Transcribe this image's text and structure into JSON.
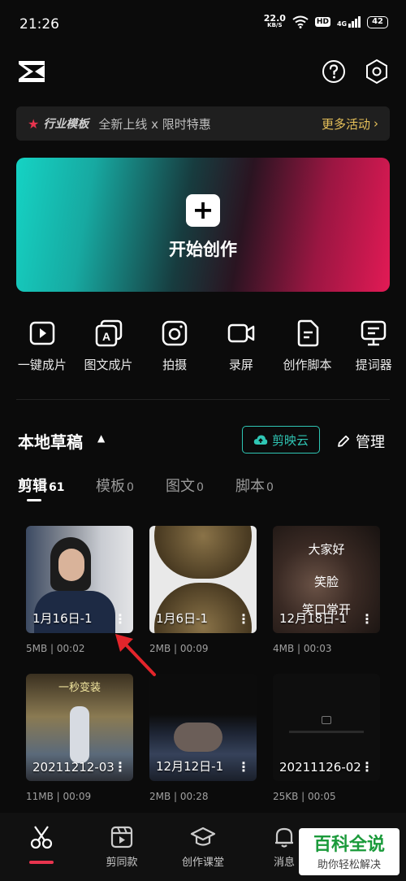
{
  "status_bar": {
    "time": "21:26",
    "net_speed_value": "22.0",
    "net_speed_unit": "KB/S",
    "hd": "HD",
    "network": "4G",
    "battery": "42"
  },
  "header": {
    "logo_icon": "capcut-logo-icon",
    "help_icon": "help-circle-icon",
    "settings_icon": "hexagon-settings-icon"
  },
  "promo": {
    "tag": "行业模板",
    "text": "全新上线 x 限时特惠",
    "more": "更多活动",
    "star_color": "#e8344e",
    "more_color": "#e7c15a"
  },
  "create": {
    "plus": "+",
    "label": "开始创作"
  },
  "tools": [
    {
      "icon": "play-square-icon",
      "label": "一键成片"
    },
    {
      "icon": "image-text-icon",
      "label": "图文成片"
    },
    {
      "icon": "camera-icon",
      "label": "拍摄"
    },
    {
      "icon": "video-record-icon",
      "label": "录屏"
    },
    {
      "icon": "script-doc-icon",
      "label": "创作脚本"
    },
    {
      "icon": "teleprompter-icon",
      "label": "提词器"
    }
  ],
  "drafts": {
    "title": "本地草稿",
    "cloud_label": "剪映云",
    "manage_label": "管理",
    "accent": "#2fc6b4"
  },
  "tabs": [
    {
      "label": "剪辑",
      "count": "61",
      "active": true
    },
    {
      "label": "模板",
      "count": "0"
    },
    {
      "label": "图文",
      "count": "0"
    },
    {
      "label": "脚本",
      "count": "0"
    }
  ],
  "items": [
    {
      "title": "1月16日-1",
      "meta": "5MB | 00:02"
    },
    {
      "title": "1月6日-1",
      "meta": "2MB | 00:09"
    },
    {
      "title": "12月18日-1",
      "meta": "4MB | 00:03",
      "overlay": [
        "大家好",
        "笑脸",
        "笑口常开"
      ]
    },
    {
      "title": "20211212-03",
      "meta": "11MB | 00:09",
      "overlay": [
        "一秒变装"
      ]
    },
    {
      "title": "12月12日-1",
      "meta": "2MB | 00:28"
    },
    {
      "title": "20211126-02",
      "meta": "25KB | 00:05"
    }
  ],
  "bottom_nav": [
    {
      "icon": "scissors-icon",
      "label": "",
      "active": true
    },
    {
      "icon": "template-clapper-icon",
      "label": "剪同款"
    },
    {
      "icon": "graduation-cap-icon",
      "label": "创作课堂"
    },
    {
      "icon": "bell-icon",
      "label": "消息"
    }
  ],
  "watermark": {
    "main": "百科全说",
    "sub": "助你轻松解决"
  }
}
